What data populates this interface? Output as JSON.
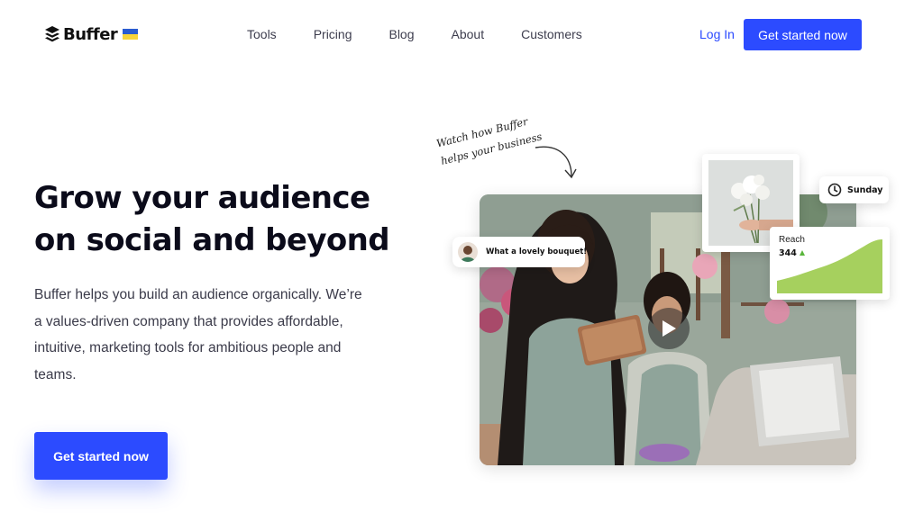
{
  "brand": {
    "name": "Buffer",
    "flag_colors": [
      "#2a5cd0",
      "#f7d43a"
    ]
  },
  "nav": {
    "links": [
      "Tools",
      "Pricing",
      "Blog",
      "About",
      "Customers"
    ],
    "login": "Log In",
    "cta": "Get started now"
  },
  "hero": {
    "title_line1": "Grow your audience",
    "title_line2": "on social and beyond",
    "description": "Buffer helps you build an audience organically. We’re a values-driven company that provides affordable, intuitive, marketing tools for ambitious people and teams.",
    "cta": "Get started now"
  },
  "annotation": {
    "line1": "Watch how Buffer",
    "line2": "helps your business"
  },
  "media": {
    "chat_text": "What a lovely bouquet!",
    "day_label": "Sunday",
    "reach_label": "Reach",
    "reach_value": "344",
    "reach_trend": "up"
  },
  "colors": {
    "accent": "#2c4bff",
    "chart_green": "#a6d05e",
    "trend_up": "#59b53a"
  }
}
